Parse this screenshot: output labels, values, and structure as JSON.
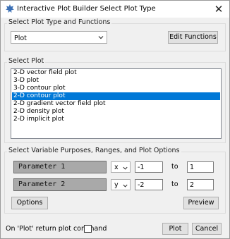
{
  "window": {
    "title": "Interactive Plot Builder Select Plot Type",
    "close_glyph": "✕"
  },
  "plot_type_group": {
    "label": "Select Plot Type and Functions",
    "dropdown_value": "Plot",
    "edit_functions_label": "Edit Functions"
  },
  "select_plot_group": {
    "label": "Select Plot",
    "items": [
      {
        "label": "2-D vector field plot",
        "selected": false
      },
      {
        "label": "3-D plot",
        "selected": false
      },
      {
        "label": "3-D contour plot",
        "selected": false
      },
      {
        "label": "2-D contour plot",
        "selected": true
      },
      {
        "label": "2-D gradient vector field plot",
        "selected": false
      },
      {
        "label": "2-D density plot",
        "selected": false
      },
      {
        "label": "2-D implicit plot",
        "selected": false
      }
    ]
  },
  "variables_group": {
    "label": "Select Variable Purposes, Ranges, and Plot Options",
    "rows": [
      {
        "name": "Parameter 1",
        "variable": "x",
        "from": "-1",
        "to_label": "to",
        "to": "1"
      },
      {
        "name": "Parameter 2",
        "variable": "y",
        "from": "-2",
        "to_label": "to",
        "to": "2"
      }
    ],
    "options_label": "Options",
    "preview_label": "Preview"
  },
  "footer": {
    "return_command_label": "On 'Plot' return plot command",
    "return_command_checked": false,
    "plot_label": "Plot",
    "cancel_label": "Cancel"
  },
  "colors": {
    "selection": "#0078d7",
    "param_fill": "#a9a9a9"
  }
}
